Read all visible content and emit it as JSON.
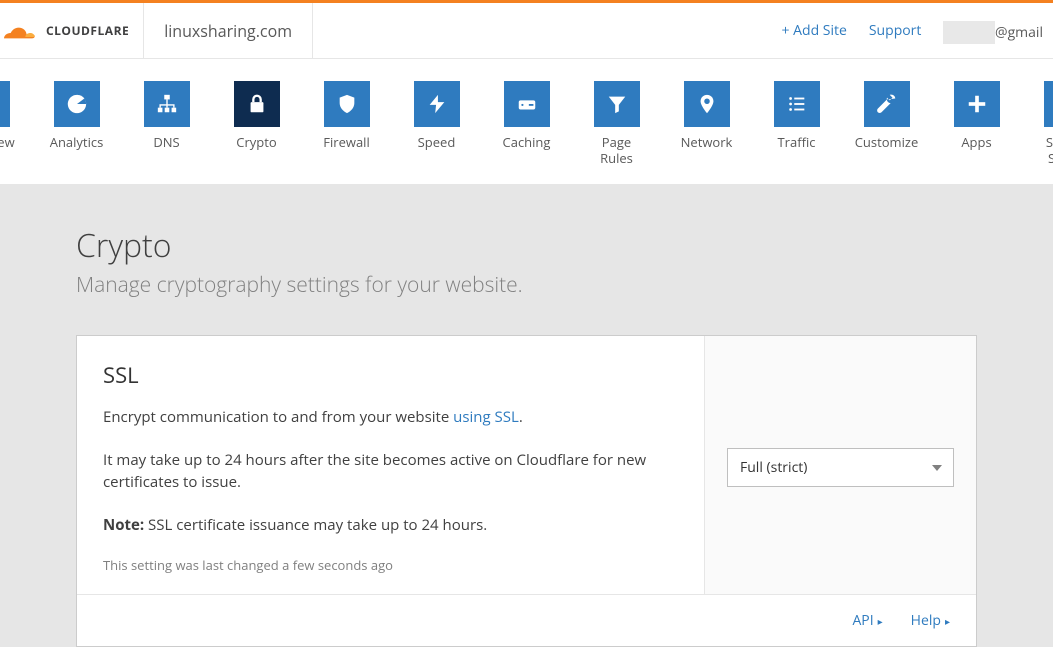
{
  "header": {
    "brand": "CLOUDFLARE",
    "domain": "linuxsharing.com",
    "add_site": "+ Add Site",
    "support": "Support",
    "email_suffix": "@gmail"
  },
  "nav": [
    {
      "label": "Overview",
      "icon": "clipboard"
    },
    {
      "label": "Analytics",
      "icon": "pie"
    },
    {
      "label": "DNS",
      "icon": "sitemap"
    },
    {
      "label": "Crypto",
      "icon": "lock",
      "active": true
    },
    {
      "label": "Firewall",
      "icon": "shield"
    },
    {
      "label": "Speed",
      "icon": "bolt"
    },
    {
      "label": "Caching",
      "icon": "drive"
    },
    {
      "label": "Page Rules",
      "icon": "funnel"
    },
    {
      "label": "Network",
      "icon": "pin"
    },
    {
      "label": "Traffic",
      "icon": "list"
    },
    {
      "label": "Customize",
      "icon": "wrench"
    },
    {
      "label": "Apps",
      "icon": "plus"
    },
    {
      "label": "Scrape Shield",
      "icon": "doc"
    }
  ],
  "page": {
    "title": "Crypto",
    "subtitle": "Manage cryptography settings for your website."
  },
  "ssl_card": {
    "title": "SSL",
    "text1_prefix": "Encrypt communication to and from your website ",
    "text1_link": "using SSL",
    "text1_suffix": ".",
    "text2": "It may take up to 24 hours after the site becomes active on Cloudflare for new certificates to issue.",
    "note_label": "Note:",
    "note_text": " SSL certificate issuance may take up to 24 hours.",
    "meta": "This setting was last changed a few seconds ago",
    "select_value": "Full (strict)",
    "footer_api": "API",
    "footer_help": "Help"
  }
}
